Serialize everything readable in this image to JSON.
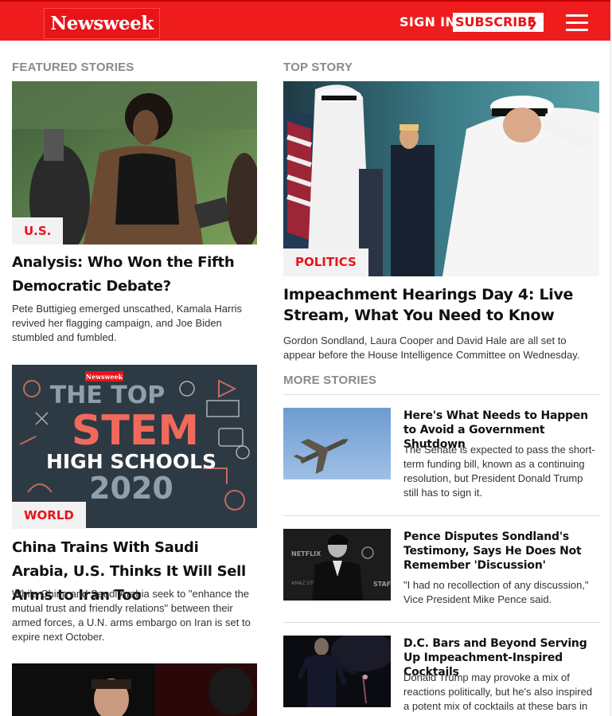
{
  "header": {
    "logo": "Newsweek",
    "sign_in": "SIGN IN",
    "subscribe": "SUBSCRIBE"
  },
  "featured": {
    "label": "FEATURED STORIES",
    "stories": [
      {
        "tag": "U.S.",
        "title": "Analysis: Who Won the Fifth Democratic Debate?",
        "summary": "Pete Buttigieg emerged unscathed, Kamala Harris revived her flagging campaign, and Joe Biden stumbled and fumbled."
      },
      {
        "tag": "WORLD",
        "title": "China Trains With Saudi Arabia, U.S. Thinks It Will Sell Arms to Iran Too",
        "summary": "While China and Saudi Arabia seek to \"enhance the mutual trust and friendly relations\" between their armed forces, a U.N. arms embargo on Iran is set to expire next October.",
        "image_text": {
          "brand": "Newsweek",
          "line1": "THE TOP",
          "line2": "STEM",
          "line3": "HIGH SCHOOLS",
          "line4": "2020"
        }
      }
    ]
  },
  "top_story": {
    "label": "TOP STORY",
    "tag": "POLITICS",
    "title": "Impeachment Hearings Day 4: Live Stream, What You Need to Know",
    "summary": "Gordon Sondland, Laura Cooper and David Hale are all set to appear before the House Intelligence Committee on Wednesday."
  },
  "more_stories": {
    "label": "MORE STORIES",
    "items": [
      {
        "title": "Here's What Needs to Happen to Avoid a Government Shutdown",
        "summary": "The Senate is expected to pass the short-term funding bill, known as a continuing resolution, but President Donald Trump still has to sign it."
      },
      {
        "title": "Pence Disputes Sondland's Testimony, Says He Does Not Remember 'Discussion'",
        "summary": "\"I had no recollection of any discussion,\" Vice President Mike Pence said.",
        "image_text": {
          "left": "NETFLIX",
          "right": "STAF",
          "bottom": "AMAZ STUD"
        }
      },
      {
        "title": "D.C. Bars and Beyond Serving Up Impeachment-Inspired Cocktails",
        "summary": "Donald Trump may provoke a mix of reactions politically, but he's also inspired a potent mix of cocktails at these bars in"
      }
    ]
  },
  "colors": {
    "brand_red": "#ee1c1c",
    "label_gray": "#8a8a8a"
  }
}
